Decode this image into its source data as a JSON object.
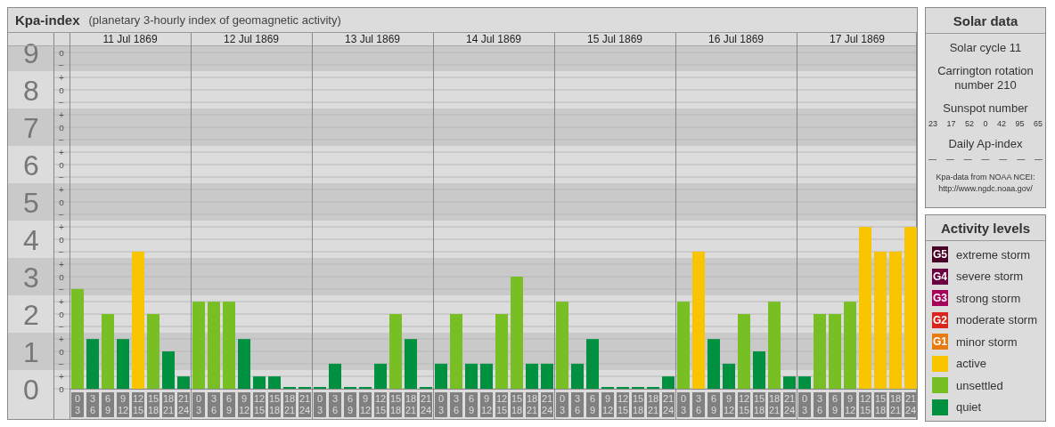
{
  "kpa_panel": {
    "title": "Kpa-index",
    "subtitle": "(planetary 3-hourly index of geomagnetic activity)",
    "y_marks": [
      [
        "o",
        "−"
      ],
      [
        "+",
        "o",
        "−"
      ],
      [
        "+",
        "o",
        "−"
      ],
      [
        "+",
        "o",
        "−"
      ],
      [
        "+",
        "o",
        "−"
      ],
      [
        "+",
        "o",
        "−"
      ],
      [
        "+",
        "o",
        "−"
      ],
      [
        "+",
        "o",
        "−"
      ],
      [
        "+",
        "o",
        "−"
      ],
      [
        "+",
        "o"
      ]
    ],
    "days": [
      {
        "date": "11 Jul 1869"
      },
      {
        "date": "12 Jul 1869"
      },
      {
        "date": "13 Jul 1869"
      },
      {
        "date": "14 Jul 1869"
      },
      {
        "date": "15 Jul 1869"
      },
      {
        "date": "16 Jul 1869"
      },
      {
        "date": "17 Jul 1869"
      }
    ],
    "chart_data": {
      "type": "bar",
      "grid": true,
      "yticks": [
        0,
        1,
        2,
        3,
        4,
        5,
        6,
        7,
        8,
        9
      ],
      "ylim": [
        0,
        9
      ],
      "categories": [
        "0 3",
        "3 6",
        "6 9",
        "9 12",
        "12 15",
        "15 18",
        "18 21",
        "21 24",
        "0 3",
        "3 6",
        "6 9",
        "9 12",
        "12 15",
        "15 18",
        "18 21",
        "21 24",
        "0 3",
        "3 6",
        "6 9",
        "9 12",
        "12 15",
        "15 18",
        "18 21",
        "21 24",
        "0 3",
        "3 6",
        "6 9",
        "9 12",
        "12 15",
        "15 18",
        "18 21",
        "21 24",
        "0 3",
        "3 6",
        "6 9",
        "9 12",
        "12 15",
        "15 18",
        "18 21",
        "21 24",
        "0 3",
        "3 6",
        "6 9",
        "9 12",
        "12 15",
        "15 18",
        "18 21",
        "21 24",
        "0 3",
        "3 6",
        "6 9",
        "9 12",
        "12 15",
        "15 18",
        "18 21",
        "21 24"
      ],
      "values": [
        2.67,
        1.33,
        2,
        1.33,
        3.67,
        2,
        1,
        0.33,
        2.33,
        2.33,
        2.33,
        1.33,
        0.33,
        0.33,
        0,
        0,
        0,
        0.67,
        0,
        0,
        0.67,
        2,
        1.33,
        0,
        0.67,
        2,
        0.67,
        0.67,
        2,
        3,
        0.67,
        0.67,
        2.33,
        0.67,
        1.33,
        0,
        0,
        0,
        0,
        0.33,
        2.33,
        3.67,
        1.33,
        0.67,
        2,
        1,
        2.33,
        0.33,
        0.33,
        2,
        2,
        2.33,
        4.33,
        3.67,
        3.67,
        4.33
      ]
    }
  },
  "solar_data": {
    "title": "Solar data",
    "solar_cycle": "Solar cycle 11",
    "carrington_rotation": "Carrington rotation number 210",
    "sunspot_title": "Sunspot number",
    "sunspot_numbers": [
      "23",
      "17",
      "52",
      "0",
      "42",
      "95",
      "65"
    ],
    "ap_title": "Daily Ap-index",
    "ap_values": [
      "—",
      "—",
      "—",
      "—",
      "—",
      "—",
      "—"
    ],
    "source": "Kpa-data from NOAA NCEI:",
    "source_url": "http://www.ngdc.noaa.gov/"
  },
  "activity_levels": {
    "title": "Activity levels",
    "items": [
      {
        "kind": "storm",
        "badge": "G5",
        "label": "extreme storm",
        "color": "#4a0026"
      },
      {
        "kind": "storm",
        "badge": "G4",
        "label": "severe storm",
        "color": "#6b0040"
      },
      {
        "kind": "storm",
        "badge": "G3",
        "label": "strong storm",
        "color": "#a6005c"
      },
      {
        "kind": "storm",
        "badge": "G2",
        "label": "moderate storm",
        "color": "#d8261d"
      },
      {
        "kind": "storm",
        "badge": "G1",
        "label": "minor storm",
        "color": "#e87b10"
      },
      {
        "kind": "plain",
        "label": "active",
        "color": "#f9c400"
      },
      {
        "kind": "plain",
        "label": "unsettled",
        "color": "#77bf22"
      },
      {
        "kind": "plain",
        "label": "quiet",
        "color": "#009140"
      }
    ]
  }
}
